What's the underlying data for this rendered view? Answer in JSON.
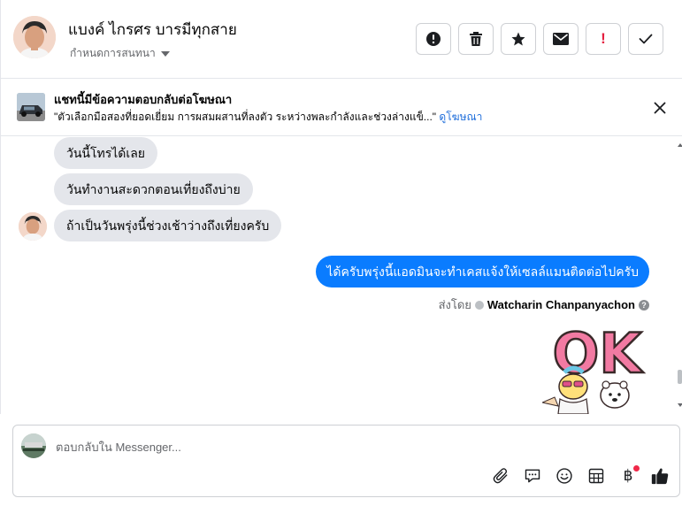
{
  "header": {
    "contact_name": "แบงค์ ไกรศร บารมีทุกสาย",
    "set_conversation_label": "กำหนดการสนทนา",
    "actions": [
      {
        "name": "spam-button",
        "icon": "alert-circle-icon"
      },
      {
        "name": "delete-button",
        "icon": "trash-icon"
      },
      {
        "name": "star-button",
        "icon": "star-icon"
      },
      {
        "name": "mark-unread-button",
        "icon": "envelope-icon"
      },
      {
        "name": "follow-up-button",
        "icon": "exclamation-icon",
        "label": "!"
      },
      {
        "name": "done-button",
        "icon": "check-icon"
      }
    ]
  },
  "ad_banner": {
    "title": "แชทนี้มีข้อความตอบกลับต่อโฆษณา",
    "body": "\"ตัวเลือกมือสองที่ยอดเยี่ยม การผสมผสานที่ลงตัว ระหว่างพละกำลังและช่วงล่างแข็...\"",
    "link": "ดูโฆษณา"
  },
  "messages": {
    "incoming": [
      "วันนี้โทรได้เลย",
      "วันทำงานสะดวกตอนเที่ยงถึงบ่าย",
      "ถ้าเป็นวันพรุ่งนี้ช่วงเช้าว่างถึงเที่ยงครับ"
    ],
    "outgoing": "ได้ครับพรุ่งนี้แอดมินจะทำเคสแจ้งให้เซลล์แมนติดต่อไปครับ",
    "sent_by_label": "ส่งโดย",
    "sent_by_name": "Watcharin Chanpanyachon",
    "help_symbol": "?",
    "sticker_text": "OK"
  },
  "composer": {
    "placeholder": "ตอบกลับใน Messenger...",
    "tools": [
      "paperclip-icon",
      "message-bubble-icon",
      "emoji-icon",
      "table-icon",
      "baht-icon",
      "thumbs-up-icon"
    ],
    "baht_symbol": "฿"
  },
  "colors": {
    "accent": "#0a7cff",
    "incoming_bubble": "#e4e6eb",
    "link": "#216fdb",
    "alert_red": "#e41e3f"
  }
}
